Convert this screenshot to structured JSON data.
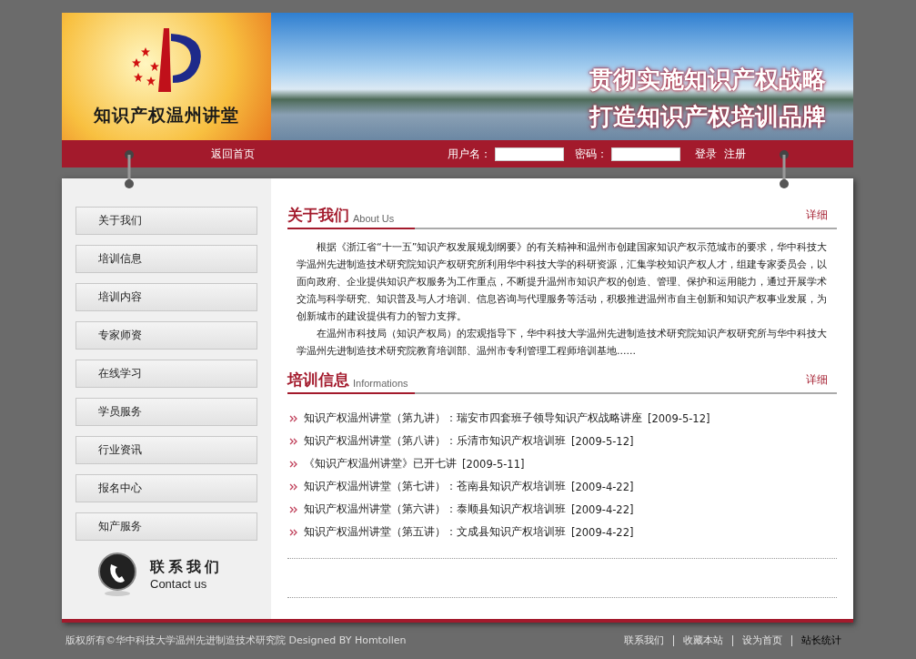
{
  "header": {
    "logo_text": "知识产权温州讲堂",
    "slogan_lines": [
      "贯彻实施知识产权战略",
      "打造知识产权培训品牌"
    ]
  },
  "nav": {
    "home_link": "返回首页",
    "username_label": "用户名：",
    "password_label": "密码：",
    "login": "登录",
    "register": "注册"
  },
  "sidebar": {
    "items": [
      "关于我们",
      "培训信息",
      "培训内容",
      "专家师资",
      "在线学习",
      "学员服务",
      "行业资讯",
      "报名中心",
      "知产服务"
    ],
    "contact": {
      "title": "联系我们",
      "subtitle": "Contact us"
    }
  },
  "about": {
    "title": "关于我们",
    "subtitle": "About Us",
    "more": "详细",
    "paragraphs": [
      "根据《浙江省“十一五”知识产权发展规划纲要》的有关精神和温州市创建国家知识产权示范城市的要求，华中科技大学温州先进制造技术研究院知识产权研究所利用华中科技大学的科研资源，汇集学校知识产权人才，组建专家委员会，以面向政府、企业提供知识产权服务为工作重点，不断提升温州市知识产权的创造、管理、保护和运用能力，通过开展学术交流与科学研究、知识普及与人才培训、信息咨询与代理服务等活动，积极推进温州市自主创新和知识产权事业发展，为创新城市的建设提供有力的智力支撑。",
      "在温州市科技局（知识产权局）的宏观指导下，华中科技大学温州先进制造技术研究院知识产权研究所与华中科技大学温州先进制造技术研究院教育培训部、温州市专利管理工程师培训基地......"
    ]
  },
  "training": {
    "title": "培训信息",
    "subtitle": "Informations",
    "more": "详细",
    "items": [
      {
        "text": "知识产权温州讲堂（第九讲）：瑞安市四套班子领导知识产权战略讲座",
        "date": "[2009-5-12]"
      },
      {
        "text": "知识产权温州讲堂（第八讲）：乐清市知识产权培训班",
        "date": "[2009-5-12]"
      },
      {
        "text": "《知识产权温州讲堂》已开七讲",
        "date": "[2009-5-11]"
      },
      {
        "text": "知识产权温州讲堂（第七讲）：苍南县知识产权培训班",
        "date": "[2009-4-22]"
      },
      {
        "text": "知识产权温州讲堂（第六讲）：泰顺县知识产权培训班",
        "date": "[2009-4-22]"
      },
      {
        "text": "知识产权温州讲堂（第五讲）：文成县知识产权培训班",
        "date": "[2009-4-22]"
      }
    ]
  },
  "footer": {
    "copyright": "版权所有©华中科技大学温州先进制造技术研究院 Designed BY Homtollen",
    "links": [
      {
        "label": "联系我们",
        "highlighted": false
      },
      {
        "label": "收藏本站",
        "highlighted": false
      },
      {
        "label": "设为首页",
        "highlighted": false
      },
      {
        "label": "站长统计",
        "highlighted": true
      }
    ]
  }
}
